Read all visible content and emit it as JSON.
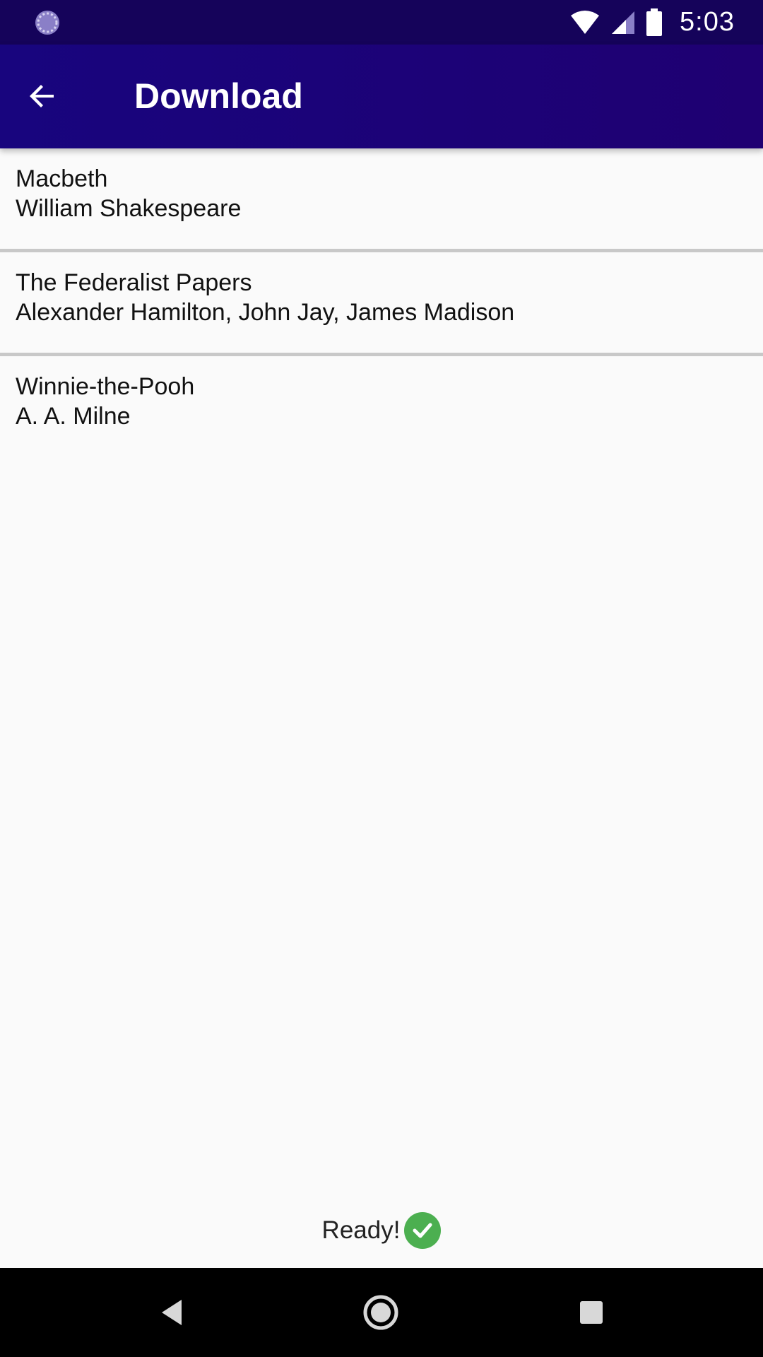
{
  "status_bar": {
    "time": "5:03",
    "left_icon": "loading-circle-icon",
    "icons": [
      "wifi-icon",
      "signal-icon",
      "battery-icon"
    ]
  },
  "app_bar": {
    "title": "Download",
    "back_icon": "arrow-back-icon"
  },
  "books": [
    {
      "title": "Macbeth",
      "author": "William Shakespeare"
    },
    {
      "title": "The Federalist Papers",
      "author": "Alexander Hamilton, John Jay, James Madison"
    },
    {
      "title": "Winnie-the-Pooh",
      "author": "A. A. Milne"
    }
  ],
  "status": {
    "text": "Ready!",
    "icon": "check-circle-icon",
    "icon_color": "#4caf50"
  },
  "nav_bar": {
    "icons": [
      "back-triangle-icon",
      "home-circle-icon",
      "recents-square-icon"
    ]
  },
  "colors": {
    "status_bar": "#15035a",
    "app_bar": "#1a0678",
    "background": "#fafafa",
    "divider": "#c8c8c8"
  }
}
